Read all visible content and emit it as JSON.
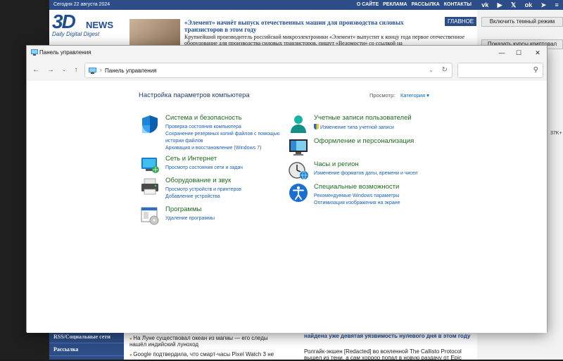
{
  "website": {
    "date": "Сегодня 22 августа 2024",
    "nav": [
      "О САЙТЕ",
      "РЕКЛАМА",
      "РАССЫЛКА",
      "КОНТАКТЫ"
    ],
    "social": [
      "VK",
      "You Tube",
      "X",
      "OK",
      "TG",
      "RSS"
    ],
    "logo_big": "3D",
    "logo_news": "NEWS",
    "logo_sub": "Daily Digital Digest",
    "headline": "«Элемент» начнёт выпуск отечественных машин для производства силовых транзисторов в этом году",
    "badge": "ГЛАВНОЕ",
    "lead": "Крупнейший производитель российской микроэлектроники «Элемент» выпустит к концу года первое отечественное оборудование для производства силовых транзисторов, пишут «Ведомости» со ссылкой на",
    "right_btn1": "Включить темный режим",
    "right_btn2": "Показать курсы криптовал",
    "right_count": "37K+",
    "left_nav": [
      "RSS/Социальные сети",
      "Рассылка"
    ],
    "news_left": [
      "На Луне существовал океан из магмы — его следы нашёл индийский луноход",
      "Google подтвердила, что смарт-часы Pixel Watch 3 не"
    ],
    "news_right_title": "найдена уже девятая уязвимость нулевого дня в этом году",
    "news_right": "Ролгайк-экшен [Redacted] во вселенной The Callisto Protocol вышел из тени, а сам хоррор попал в новую раздачу от Epic"
  },
  "window": {
    "title": "Панель управления",
    "address_path": "Панель управления",
    "search_placeholder": "",
    "heading": "Настройка параметров компьютера",
    "view_by_label": "Просмотр:",
    "view_by_value": "Категория ▾",
    "categories_left": [
      {
        "title": "Система и безопасность",
        "icon": "shield-icon",
        "links": [
          "Проверка состояния компьютера",
          "Сохранение резервных копий файлов с помощью",
          "истории файлов",
          "Архивация и восстановление (Windows 7)"
        ]
      },
      {
        "title": "Сеть и Интернет",
        "icon": "network-icon",
        "links": [
          "Просмотр состояния сети и задач"
        ]
      },
      {
        "title": "Оборудование и звук",
        "icon": "printer-icon",
        "links": [
          "Просмотр устройств и принтеров",
          "Добавление устройства"
        ]
      },
      {
        "title": "Программы",
        "icon": "programs-icon",
        "links": [
          "Удаление программы"
        ]
      }
    ],
    "categories_right": [
      {
        "title": "Учетные записи пользователей",
        "icon": "user-icon",
        "links": [
          "Изменение типа учетной записи"
        ]
      },
      {
        "title": "Оформление и персонализация",
        "icon": "monitor-icon",
        "links": []
      },
      {
        "title": "Часы и регион",
        "icon": "clock-icon",
        "links": [
          "Изменение форматов даты, времени и чисел"
        ]
      },
      {
        "title": "Специальные возможности",
        "icon": "accessibility-icon",
        "links": [
          "Рекомендуемые Windows параметры",
          "Оптимизация изображения на экране"
        ]
      }
    ]
  }
}
